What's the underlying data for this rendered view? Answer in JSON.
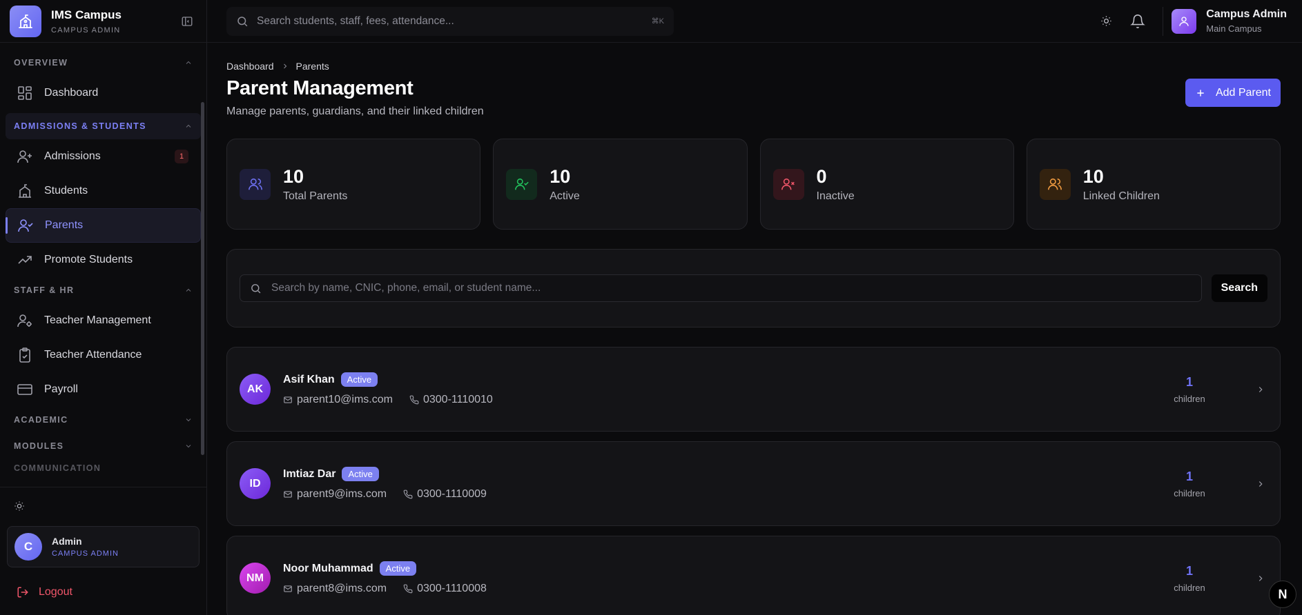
{
  "brand": {
    "title": "IMS Campus",
    "subtitle": "CAMPUS ADMIN"
  },
  "sidebar": {
    "sections": [
      {
        "label": "OVERVIEW"
      },
      {
        "label": "ADMISSIONS & STUDENTS"
      },
      {
        "label": "STAFF & HR"
      },
      {
        "label": "ACADEMIC"
      },
      {
        "label": "MODULES"
      },
      {
        "label": "COMMUNICATION"
      }
    ],
    "items": [
      {
        "label": "Dashboard"
      },
      {
        "label": "Admissions",
        "badge": "1"
      },
      {
        "label": "Students"
      },
      {
        "label": "Parents"
      },
      {
        "label": "Promote Students"
      },
      {
        "label": "Teacher Management"
      },
      {
        "label": "Teacher Attendance"
      },
      {
        "label": "Payroll"
      }
    ],
    "user": {
      "initial": "C",
      "name": "Admin",
      "role": "CAMPUS ADMIN"
    },
    "logout": "Logout"
  },
  "topbar": {
    "search_placeholder": "Search students, staff, fees, attendance...",
    "shortcut": "⌘K",
    "admin_name": "Campus Admin",
    "admin_campus": "Main Campus"
  },
  "breadcrumb": [
    "Dashboard",
    "Parents"
  ],
  "page": {
    "title": "Parent Management",
    "subtitle": "Manage parents, guardians, and their linked children",
    "add_button": "Add Parent"
  },
  "stats": [
    {
      "value": "10",
      "label": "Total Parents",
      "color": "#6f72f5"
    },
    {
      "value": "10",
      "label": "Active",
      "color": "#22c55e"
    },
    {
      "value": "0",
      "label": "Inactive",
      "color": "#f0566a"
    },
    {
      "value": "10",
      "label": "Linked Children",
      "color": "#f59e42"
    }
  ],
  "search": {
    "placeholder": "Search by name, CNIC, phone, email, or student name...",
    "button": "Search"
  },
  "parents": [
    {
      "initials": "AK",
      "name": "Asif Khan",
      "status": "Active",
      "email": "parent10@ims.com",
      "phone": "0300-1110010",
      "children": "1",
      "children_label": "children"
    },
    {
      "initials": "ID",
      "name": "Imtiaz Dar",
      "status": "Active",
      "email": "parent9@ims.com",
      "phone": "0300-1110009",
      "children": "1",
      "children_label": "children"
    },
    {
      "initials": "NM",
      "name": "Noor Muhammad",
      "status": "Active",
      "email": "parent8@ims.com",
      "phone": "0300-1110008",
      "children": "1",
      "children_label": "children"
    }
  ],
  "dev_badge": "N"
}
